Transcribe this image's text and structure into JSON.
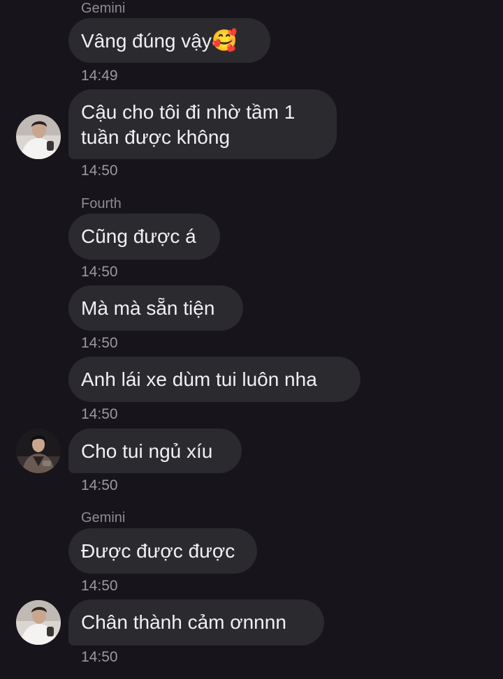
{
  "messages": [
    {
      "sender": "Gemini",
      "text": "Vâng đúng vậy",
      "emoji": "🥰",
      "time": "14:49"
    },
    {
      "text_line1": "Cậu cho tôi đi nhờ tầm 1",
      "text_line2": "tuần được không",
      "time": "14:50"
    },
    {
      "sender": "Fourth",
      "text": "Cũng được á",
      "time": "14:50"
    },
    {
      "text": "Mà mà sẵn tiện",
      "time": "14:50"
    },
    {
      "text": "Anh lái xe dùm tui luôn nha",
      "time": "14:50"
    },
    {
      "text": "Cho tui ngủ xíu",
      "time": "14:50"
    },
    {
      "sender": "Gemini",
      "text": "Được được được",
      "time": "14:50"
    },
    {
      "text": "Chân thành cảm ơnnnn",
      "time": "14:50"
    }
  ],
  "colors": {
    "background": "#17151b",
    "bubble": "#2b2a2f",
    "text": "#f1f0f3",
    "meta": "#8e8c93"
  },
  "icons": {
    "avatar_a": "avatar-white-shirt",
    "avatar_b": "avatar-dark-outfit"
  }
}
